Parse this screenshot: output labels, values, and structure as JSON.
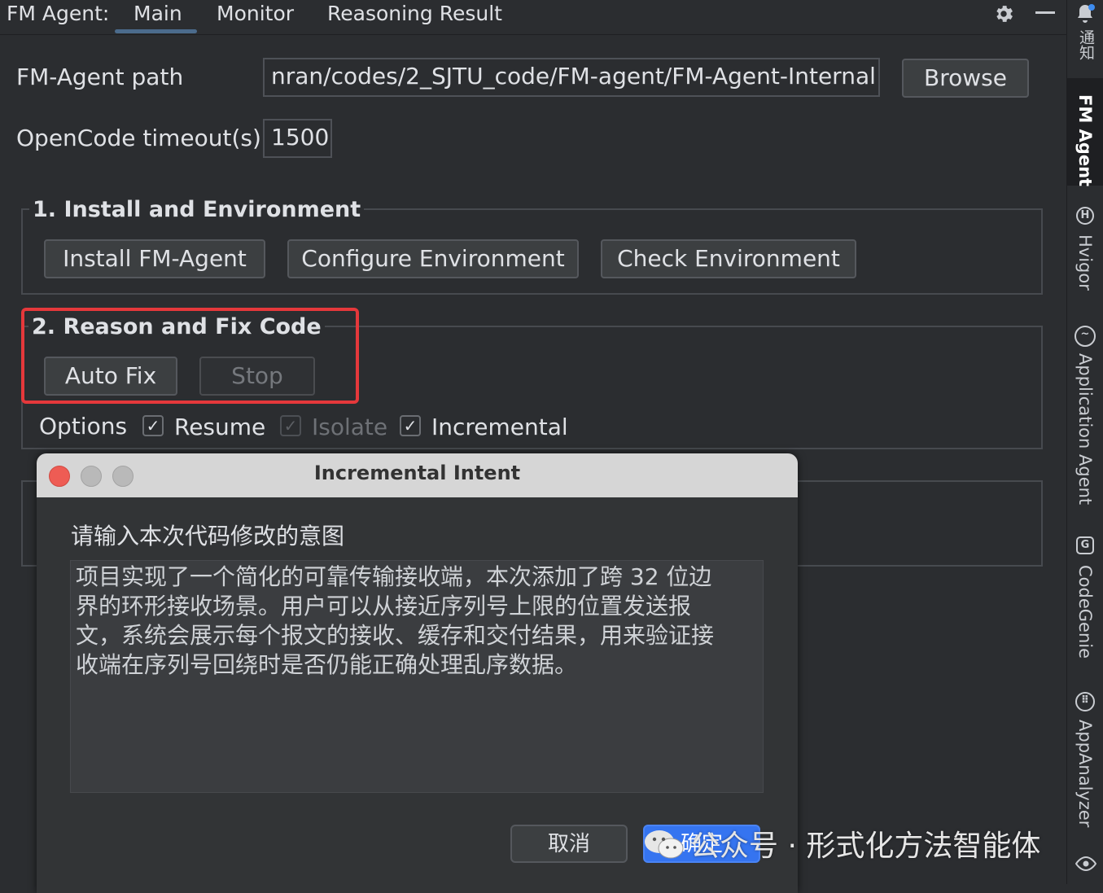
{
  "header": {
    "app_label": "FM Agent:",
    "tabs": [
      "Main",
      "Monitor",
      "Reasoning Result"
    ],
    "active_tab": "Main"
  },
  "settings": {
    "path_label": "FM-Agent path",
    "path_value": "nran/codes/2_SJTU_code/FM-agent/FM-Agent-Internal",
    "browse_label": "Browse",
    "timeout_label": "OpenCode timeout(s)",
    "timeout_value": "1500"
  },
  "section1": {
    "title": "1. Install and Environment",
    "buttons": [
      "Install FM-Agent",
      "Configure Environment",
      "Check Environment"
    ]
  },
  "section2": {
    "title": "2. Reason and Fix Code",
    "auto_fix": "Auto Fix",
    "stop": "Stop",
    "options_label": "Options",
    "options": [
      {
        "label": "Resume",
        "checked": true,
        "enabled": true
      },
      {
        "label": "Isolate",
        "checked": true,
        "enabled": false
      },
      {
        "label": "Incremental",
        "checked": true,
        "enabled": true
      }
    ]
  },
  "right_strip": {
    "notifications": "通知",
    "items": [
      "FM Agent",
      "Hvigor",
      "Application Agent",
      "CodeGenie",
      "AppAnalyzer"
    ]
  },
  "dialog": {
    "title": "Incremental Intent",
    "prompt": "请输入本次代码修改的意图",
    "text": "项目实现了一个简化的可靠传输接收端，本次添加了跨 32 位边\n界的环形接收场景。用户可以从接近序列号上限的位置发送报\n文，系统会展示每个报文的接收、缓存和交付结果，用来验证接\n收端在序列号回绕时是否仍能正确处理乱序数据。",
    "cancel": "取消",
    "ok": "确定"
  },
  "watermark": "公众号 · 形式化方法智能体",
  "colors": {
    "background": "#2b2d30",
    "highlight": "#e5383b",
    "primary_button": "#3574f0"
  }
}
